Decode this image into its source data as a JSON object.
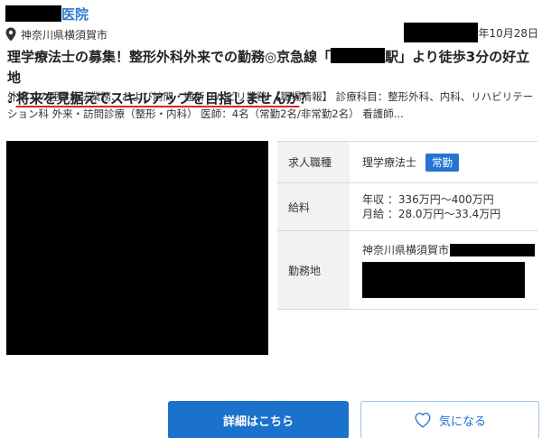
{
  "header": {
    "clinic_suffix": "医院",
    "location": "神奈川県横須賀市",
    "date_suffix": "年10月28日"
  },
  "title": {
    "part1": "理学療法士の募集！整形外科外来での勤務◎京急線「",
    "part2": "駅」より徒歩3分の好立地",
    "part3": "♪",
    "part4": "将来を見据えてスキルアップを目指しませんか",
    "part5": "？"
  },
  "description": "外来での理学療法業務、および訪問・通所リハビリ業務 【職場情報】 診療科目：整形外科、内科、リハビリテーション科 外来・訪問診療（整形・内科） 医師：4名（常勤2名/非常勤2名） 看護師...",
  "info": {
    "job_label": "求人職種",
    "job_value": "理学療法士",
    "job_badge": "常勤",
    "salary_label": "給料",
    "salary_annual": "年収 ：336万円〜400万円",
    "salary_monthly": "月給 ：28.0万円〜33.4万円",
    "place_label": "勤務地",
    "place_value": "神奈川県横須賀市"
  },
  "buttons": {
    "detail": "詳細はこちら",
    "favorite": "気になる"
  },
  "colors": {
    "link_blue": "#2c7ac8",
    "button_blue": "#1a72cc",
    "badge_blue": "#2575d0",
    "underline_red": "#e0242a"
  },
  "icons": {
    "location": "map-pin-icon",
    "favorite": "heart-icon"
  }
}
